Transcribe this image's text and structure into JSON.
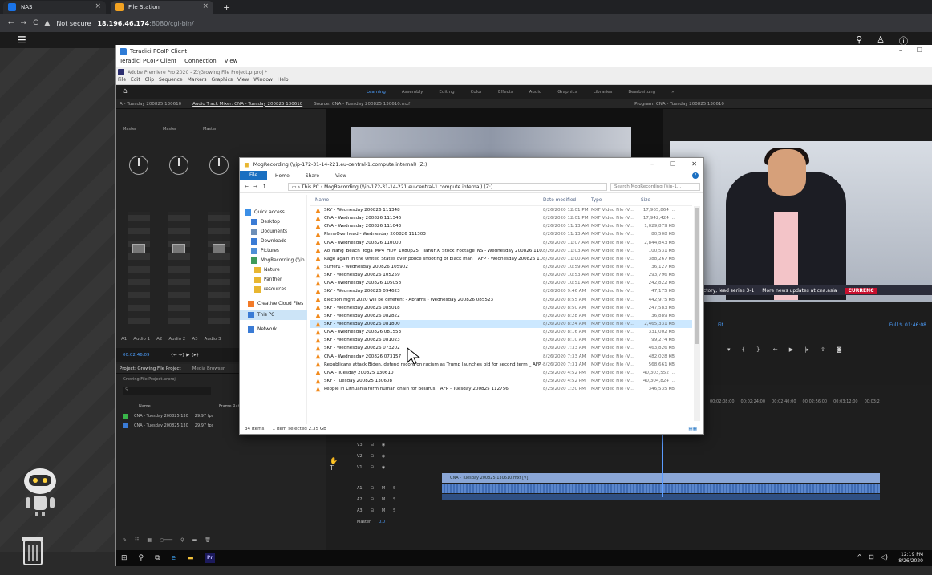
{
  "browser": {
    "tabs": [
      {
        "label": "NAS"
      },
      {
        "label": "File Station"
      }
    ],
    "new_tab": "+",
    "address": {
      "security": "Not secure",
      "host": "18.196.46.174",
      "port": ":8080",
      "path": "/cgi-bin/"
    }
  },
  "pcoip": {
    "window_title": "Teradici PCoIP Client",
    "menu": [
      "Teradici PCoIP Client",
      "Connection",
      "View"
    ]
  },
  "premiere": {
    "title": "Adobe Premiere Pro 2020 - Z:\\Growing File Project.prproj *",
    "menu": [
      "File",
      "Edit",
      "Clip",
      "Sequence",
      "Markers",
      "Graphics",
      "View",
      "Window",
      "Help"
    ],
    "workspaces": [
      "Learning",
      "Assembly",
      "Editing",
      "Color",
      "Effects",
      "Audio",
      "Graphics",
      "Libraries",
      "Bearbeitung",
      "»"
    ],
    "panels": {
      "left_tab1": "A - Tuesday 200825 130610",
      "left_tab2": "Audio Track Mixer: CNA - Tuesday 200825 130610",
      "source": "Source: CNA - Tuesday 200825 130610.mxf",
      "program": "Program: CNA - Tuesday 200825 130610"
    },
    "mixer": {
      "strip_labels": [
        "Master",
        "Master",
        "Master"
      ],
      "tracks": [
        "A1",
        "Audio 1",
        "A2",
        "Audio 2",
        "A3",
        "Audio 3"
      ],
      "timecode": "00:02:46:09"
    },
    "project": {
      "tabs": [
        "Project: Growing File Project",
        "Media Browser"
      ],
      "file": "Growing File Project.prproj",
      "col_name": "Name",
      "col_rate": "Frame Rat",
      "items": [
        {
          "name": "CNA - Tuesday 200825 130",
          "rate": "29.97 fps"
        },
        {
          "name": "CNA - Tuesday 200825 130",
          "rate": "29.97 fps"
        }
      ]
    },
    "program": {
      "fit": "Fit",
      "full": "Full",
      "timecode": "01:46:08",
      "ticker": [
        "n 135-115 victory, lead series 3-1",
        "More news updates at cna.asia",
        "CURRENC"
      ]
    },
    "timeline": {
      "ruler": [
        "00:02:08:00",
        "00:02:24:00",
        "00:02:40:00",
        "00:02:56:00",
        "00:03:12:00",
        "00:03:2"
      ],
      "tracks": [
        "V3",
        "V2",
        "V1",
        "A1",
        "A2",
        "A3",
        "Master"
      ],
      "master_value": "0.0",
      "clip_label": "CNA - Tuesday 200825 130610.mxf [V]"
    }
  },
  "taskbar": {
    "time": "12:19 PM",
    "date": "8/26/2020"
  },
  "explorer": {
    "title": "MogRecording (\\\\ip-172-31-14-221.eu-central-1.compute.internal) (Z:)",
    "ribbon": [
      "File",
      "Home",
      "Share",
      "View"
    ],
    "path": [
      "This PC",
      "MogRecording (\\\\ip-172-31-14-221.eu-central-1.compute.internal) (Z:)"
    ],
    "search_placeholder": "Search MogRecording (\\\\ip-1...",
    "nav": [
      {
        "label": "Quick access"
      },
      {
        "label": "Desktop"
      },
      {
        "label": "Documents"
      },
      {
        "label": "Downloads"
      },
      {
        "label": "Pictures"
      },
      {
        "label": "MogRecording (\\\\ip"
      },
      {
        "label": "Nature"
      },
      {
        "label": "Panther"
      },
      {
        "label": "resources"
      },
      {
        "label": "Creative Cloud Files"
      },
      {
        "label": "This PC"
      },
      {
        "label": "Network"
      }
    ],
    "columns": {
      "name": "Name",
      "date": "Date modified",
      "type": "Type",
      "size": "Size"
    },
    "files": [
      {
        "name": "SKY - Wednesday 200826 111348",
        "date": "8/26/2020 12:01 PM",
        "type": "MXF Video File (V...",
        "size": "17,965,864 ..."
      },
      {
        "name": "CNA - Wednesday 200826 111346",
        "date": "8/26/2020 12:01 PM",
        "type": "MXF Video File (V...",
        "size": "17,942,424 ..."
      },
      {
        "name": "CNA - Wednesday 200826 111043",
        "date": "8/26/2020 11:13 AM",
        "type": "MXF Video File (V...",
        "size": "1,029,879 KB"
      },
      {
        "name": "PlaneOverhead - Wednesday 200826 111303",
        "date": "8/26/2020 11:13 AM",
        "type": "MXF Video File (V...",
        "size": "80,508 KB"
      },
      {
        "name": "CNA - Wednesday 200826 110000",
        "date": "8/26/2020 11:07 AM",
        "type": "MXF Video File (V...",
        "size": "2,844,843 KB"
      },
      {
        "name": "Ao_Nang_Beach_Yoga_MP4_HDV_1080p25__TanuriX_Stock_Footage_NS - Wednesday 200826 1103...",
        "date": "8/26/2020 11:03 AM",
        "type": "MXF Video File (V...",
        "size": "100,531 KB"
      },
      {
        "name": "Rage again in the United States over police shooting of black man _ AFP - Wednesday 200826 110...",
        "date": "8/26/2020 11:00 AM",
        "type": "MXF Video File (V...",
        "size": "388,267 KB"
      },
      {
        "name": "Surfer1 - Wednesday 200826 105902",
        "date": "8/26/2020 10:59 AM",
        "type": "MXF Video File (V...",
        "size": "36,127 KB"
      },
      {
        "name": "SKY - Wednesday 200826 105259",
        "date": "8/26/2020 10:53 AM",
        "type": "MXF Video File (V...",
        "size": "293,796 KB"
      },
      {
        "name": "CNA - Wednesday 200826 105058",
        "date": "8/26/2020 10:51 AM",
        "type": "MXF Video File (V...",
        "size": "242,822 KB"
      },
      {
        "name": "SKY - Wednesday 200826 094623",
        "date": "8/26/2020 9:46 AM",
        "type": "MXF Video File (V...",
        "size": "47,175 KB"
      },
      {
        "name": "Election night 2020 will be different - Abrams - Wednesday 200826 085523",
        "date": "8/26/2020 8:55 AM",
        "type": "MXF Video File (V...",
        "size": "442,975 KB"
      },
      {
        "name": "SKY - Wednesday 200826 085018",
        "date": "8/26/2020 8:50 AM",
        "type": "MXF Video File (V...",
        "size": "247,583 KB"
      },
      {
        "name": "SKY - Wednesday 200826 082822",
        "date": "8/26/2020 8:28 AM",
        "type": "MXF Video File (V...",
        "size": "36,889 KB"
      },
      {
        "name": "SKY - Wednesday 200826 081800",
        "date": "8/26/2020 8:24 AM",
        "type": "MXF Video File (V...",
        "size": "2,465,331 KB",
        "selected": true
      },
      {
        "name": "CNA - Wednesday 200826 081553",
        "date": "8/26/2020 8:16 AM",
        "type": "MXF Video File (V...",
        "size": "331,002 KB"
      },
      {
        "name": "SKY - Wednesday 200826 081023",
        "date": "8/26/2020 8:10 AM",
        "type": "MXF Video File (V...",
        "size": "99,274 KB"
      },
      {
        "name": "SKY - Wednesday 200826 073202",
        "date": "8/26/2020 7:33 AM",
        "type": "MXF Video File (V...",
        "size": "463,826 KB"
      },
      {
        "name": "CNA - Wednesday 200826 073157",
        "date": "8/26/2020 7:33 AM",
        "type": "MXF Video File (V...",
        "size": "482,028 KB"
      },
      {
        "name": "Republicans attack Biden, defend record on racism as Trump launches bid for second term _ AFP -...",
        "date": "8/26/2020 7:31 AM",
        "type": "MXF Video File (V...",
        "size": "568,661 KB"
      },
      {
        "name": "CNA - Tuesday 200825 130610",
        "date": "8/25/2020 4:52 PM",
        "type": "MXF Video File (V...",
        "size": "40,303,552 ..."
      },
      {
        "name": "SKY - Tuesday 200825 130608",
        "date": "8/25/2020 4:52 PM",
        "type": "MXF Video File (V...",
        "size": "40,304,824 ..."
      },
      {
        "name": "People in Lithuania form human chain for Belarus _ AFP - Tuesday 200825 112756",
        "date": "8/25/2020 1:20 PM",
        "type": "MXF Video File (V...",
        "size": "346,535 KB"
      }
    ],
    "status": {
      "count": "34 items",
      "selected": "1 item selected 2.35 GB"
    }
  },
  "colors": {
    "accent": "#1a6fc1",
    "selection": "#cce8ff",
    "premiere_blue": "#4c9fff"
  }
}
